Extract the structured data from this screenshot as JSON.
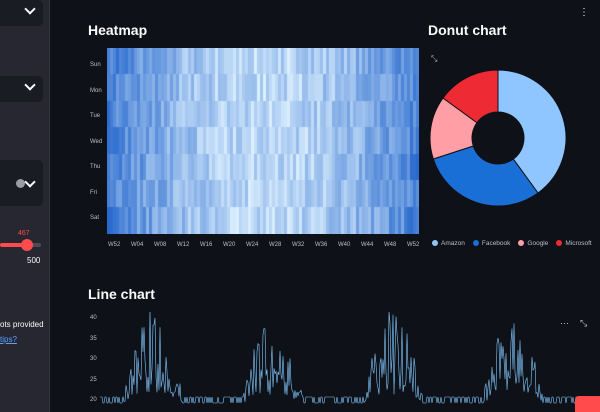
{
  "sidebar": {
    "slider_value": "467",
    "slider_max": "500",
    "note_text": "ots provided",
    "link_text": "tips?"
  },
  "menu_icon": "⋮",
  "heatmap": {
    "title": "Heatmap",
    "days": [
      "Sun",
      "Mon",
      "Tue",
      "Wed",
      "Thu",
      "Fri",
      "Sat"
    ],
    "weeks": [
      "W52",
      "W04",
      "W08",
      "W12",
      "W16",
      "W20",
      "W24",
      "W28",
      "W32",
      "W36",
      "W40",
      "W44",
      "W48",
      "W52"
    ]
  },
  "donut": {
    "title": "Donut chart",
    "legend": [
      {
        "name": "Amazon",
        "color": "#8fc6ff"
      },
      {
        "name": "Facebook",
        "color": "#1a6fd6"
      },
      {
        "name": "Google",
        "color": "#ff9fa5"
      },
      {
        "name": "Microsoft",
        "color": "#ee2a34"
      }
    ]
  },
  "line": {
    "title": "Line chart",
    "yticks": [
      "40",
      "35",
      "30",
      "25",
      "20"
    ]
  },
  "chart_data": [
    {
      "type": "heatmap",
      "title": "Heatmap",
      "y": [
        "Sun",
        "Mon",
        "Tue",
        "Wed",
        "Thu",
        "Fri",
        "Sat"
      ],
      "x": [
        "W52",
        "W04",
        "W08",
        "W12",
        "W16",
        "W20",
        "W24",
        "W28",
        "W32",
        "W36",
        "W40",
        "W44",
        "W48",
        "W52"
      ],
      "colormap": "blues"
    },
    {
      "type": "pie",
      "title": "Donut chart",
      "categories": [
        "Amazon",
        "Facebook",
        "Google",
        "Microsoft"
      ],
      "values": [
        40,
        30,
        15,
        15
      ],
      "colors": [
        "#8fc6ff",
        "#1a6fd6",
        "#ff9fa5",
        "#ee2a34"
      ]
    },
    {
      "type": "line",
      "title": "Line chart",
      "ylim": [
        20,
        40
      ]
    }
  ]
}
